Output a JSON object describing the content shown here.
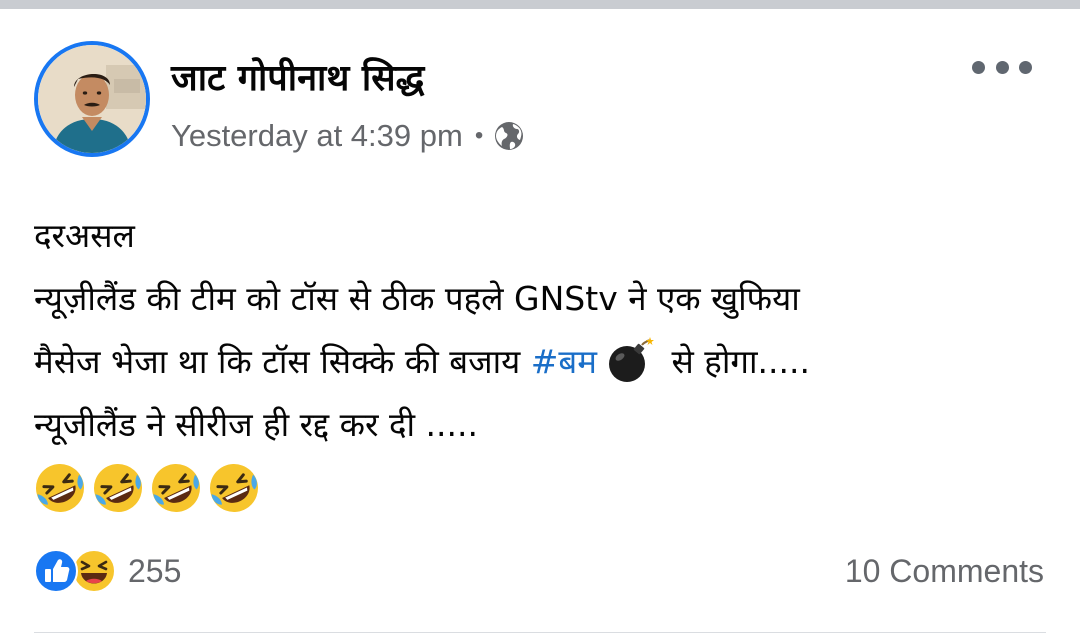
{
  "post": {
    "author_name": "जाट गोपीनाथ सिद्ध",
    "timestamp": "Yesterday at 4:39 pm",
    "separator": "•",
    "privacy_icon": "globe-icon",
    "more_icon": "more-options-icon",
    "body": {
      "line1": "दरअसल",
      "line2": "न्यूज़ीलैंड की टीम को टॉस से ठीक पहले GNStv ने एक खुफिया",
      "line3_prefix": "मैसेज भेजा था कि टॉस सिक्के की बजाय ",
      "line3_hashtag": "#बम",
      "line3_suffix": " से होगा.....",
      "line4": "न्यूजीलैंड ने सीरीज ही रद्द कर दी .....",
      "laugh_emoji_count": 4
    }
  },
  "footer": {
    "reaction_icons": [
      "like-icon",
      "haha-icon"
    ],
    "reaction_count": "255",
    "comments_count": "10 Comments"
  },
  "colors": {
    "accent": "#1877f2",
    "hashtag": "#1a6ec8",
    "secondary_text": "#65676b",
    "primary_text": "#050505"
  }
}
